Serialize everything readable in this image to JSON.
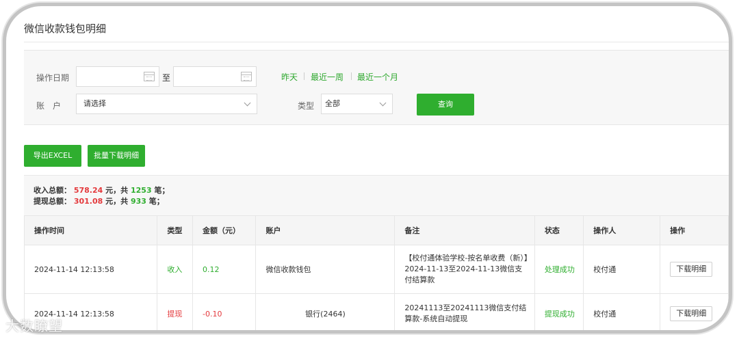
{
  "page": {
    "title": "微信收款钱包明细"
  },
  "filter": {
    "date_label": "操作日期",
    "date_to": "至",
    "quick": [
      "昨天",
      "最近一周",
      "最近一个月"
    ],
    "account_label": "账　户",
    "account_placeholder": "请选择",
    "type_label": "类型",
    "type_value": "全部",
    "query_label": "查询"
  },
  "actions": {
    "export": "导出EXCEL",
    "batch": "批量下载明细"
  },
  "summary": {
    "income_label": "收入总额：",
    "income_amount": "578.24",
    "income_mid": "元，共",
    "income_count": "1253",
    "income_end": "笔；",
    "withdraw_label": "提现总额：",
    "withdraw_amount": "301.08",
    "withdraw_mid": "元，共",
    "withdraw_count": "933",
    "withdraw_end": "笔；"
  },
  "table": {
    "headers": [
      "操作时间",
      "类型",
      "金额（元）",
      "账户",
      "备注",
      "状态",
      "操作人",
      "操作"
    ],
    "rows": [
      {
        "time": "2024-11-14 12:13:58",
        "type": "收入",
        "amount": "0.12",
        "account": "微信收款钱包",
        "note": "【校付通体验学校-按名单收费（新）】2024-11-13至2024-11-13微信支付结算款",
        "status": "处理成功",
        "operator": "校付通",
        "action": "下载明细"
      },
      {
        "time": "2024-11-14 12:13:58",
        "type": "提现",
        "amount": "-0.10",
        "account": "银行(2464)",
        "note": "20241113至20241113微信支付结算款-系统自动提现",
        "status": "提现成功",
        "operator": "校付通",
        "action": "下载明细"
      }
    ]
  },
  "watermark": "大数瞭望",
  "colors": {
    "green": "#2fae2f",
    "red": "#e4393c"
  }
}
